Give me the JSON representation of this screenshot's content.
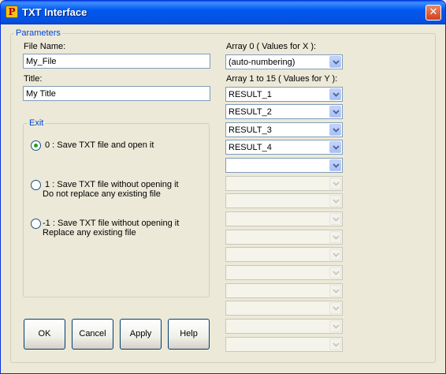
{
  "window": {
    "title": "TXT Interface",
    "app_icon": "p-logo-icon",
    "close_icon": "close-icon"
  },
  "parameters": {
    "legend": "Parameters",
    "file_name_label": "File Name:",
    "file_name_value": "My_File",
    "title_label": "Title:",
    "title_value": "My Title"
  },
  "exit": {
    "legend": "Exit",
    "options": [
      {
        "line1": "0 : Save TXT file and open it",
        "line2": "",
        "checked": true
      },
      {
        "line1": "1 : Save TXT file without opening it",
        "line2": "Do not replace any existing file",
        "checked": false
      },
      {
        "line1": "-1 : Save TXT file without opening it",
        "line2": "Replace any existing file",
        "checked": false
      }
    ]
  },
  "arrays": {
    "x_label": "Array 0 ( Values for X ):",
    "x_value": "(auto-numbering)",
    "y_label": "Array 1 to 15 ( Values for Y ):",
    "y_values": [
      "RESULT_1",
      "RESULT_2",
      "RESULT_3",
      "RESULT_4",
      "",
      "",
      "",
      "",
      "",
      "",
      "",
      "",
      "",
      "",
      ""
    ],
    "y_enabled_count": 5
  },
  "buttons": {
    "ok": "OK",
    "cancel": "Cancel",
    "apply": "Apply",
    "help": "Help"
  },
  "colors": {
    "group_legend": "#0046D5",
    "title_bar": "#0058EE",
    "radio_dot": "#21A121"
  }
}
